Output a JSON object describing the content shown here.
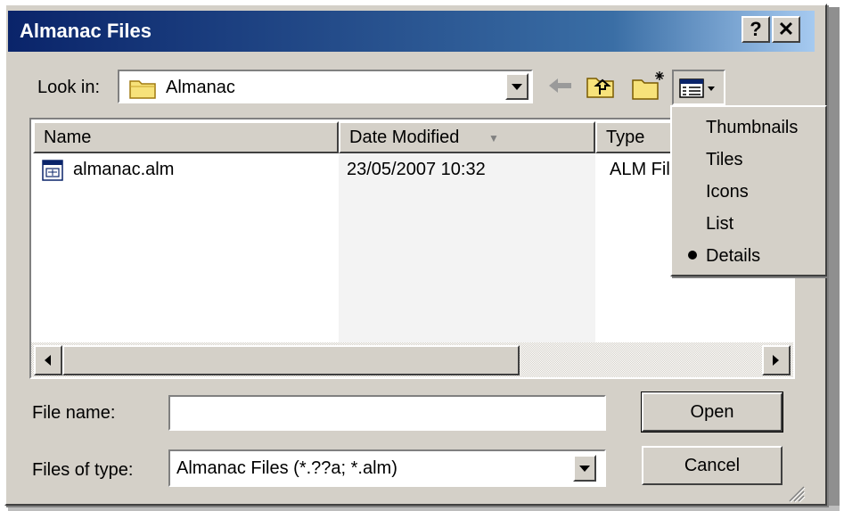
{
  "window": {
    "title": "Almanac Files",
    "help_label": "?",
    "close_label": "✕"
  },
  "lookin": {
    "label": "Look in:",
    "value": "Almanac"
  },
  "columns": {
    "name": "Name",
    "date": "Date Modified",
    "type": "Type"
  },
  "files": [
    {
      "name": "almanac.alm",
      "date": "23/05/2007 10:32",
      "type": "ALM Fil"
    }
  ],
  "filename": {
    "label": "File name:",
    "value": ""
  },
  "filetype": {
    "label": "Files of type:",
    "value": "Almanac Files (*.??a; *.alm)"
  },
  "buttons": {
    "open": "Open",
    "cancel": "Cancel"
  },
  "views_menu": {
    "items": [
      "Thumbnails",
      "Tiles",
      "Icons",
      "List",
      "Details"
    ],
    "selected": "Details"
  },
  "icons": {
    "back": "back-arrow-icon",
    "up": "up-folder-icon",
    "new_folder": "new-folder-icon",
    "views": "views-menu-icon"
  }
}
